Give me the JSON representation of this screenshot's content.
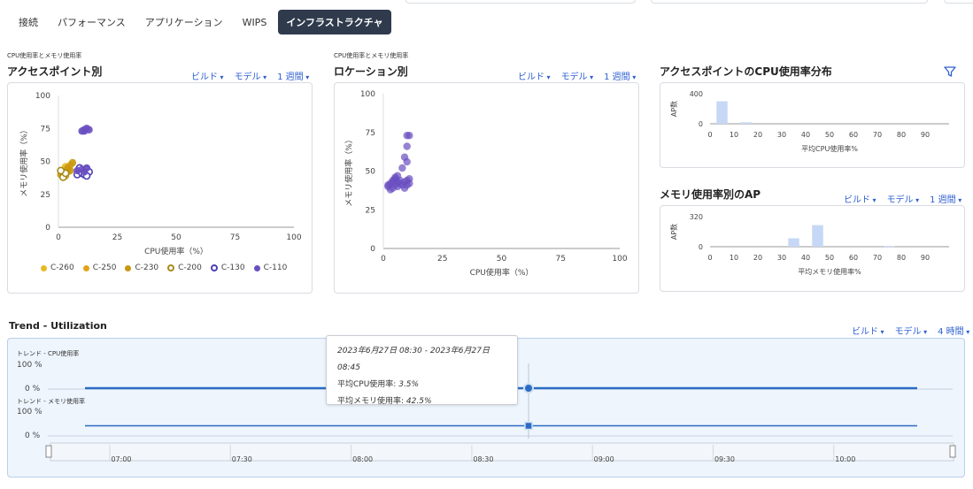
{
  "tabs": [
    {
      "label": "接続",
      "active": false
    },
    {
      "label": "パフォーマンス",
      "active": false
    },
    {
      "label": "アプリケーション",
      "active": false
    },
    {
      "label": "WIPS",
      "active": false
    },
    {
      "label": "インフラストラクチャ",
      "active": true
    }
  ],
  "scatter_ap": {
    "caption": "CPU使用率とメモリ使用率",
    "title": "アクセスポイント別",
    "filters": [
      "ビルド",
      "モデル",
      "1 週間"
    ]
  },
  "scatter_loc": {
    "caption": "CPU使用率とメモリ使用率",
    "title": "ロケーション別",
    "filters": [
      "ビルド",
      "モデル",
      "1 週間"
    ]
  },
  "cpu_dist": {
    "title": "アクセスポイントのCPU使用率分布"
  },
  "mem_dist": {
    "title": "メモリ使用率別のAP",
    "filters": [
      "ビルド",
      "モデル",
      "1 週間"
    ]
  },
  "legend": [
    {
      "label": "C-260",
      "color": "#e8b923",
      "style": "dot"
    },
    {
      "label": "C-250",
      "color": "#e0a41a",
      "style": "dot"
    },
    {
      "label": "C-230",
      "color": "#c9980f",
      "style": "dot"
    },
    {
      "label": "C-200",
      "color": "#a88a18",
      "style": "ring"
    },
    {
      "label": "C-130",
      "color": "#4b3fb4",
      "style": "ring"
    },
    {
      "label": "C-110",
      "color": "#6a4fc1",
      "style": "dot"
    }
  ],
  "chart_data": [
    {
      "type": "scatter",
      "title": "アクセスポイント別",
      "xlabel": "CPU使用率（%）",
      "ylabel": "メモリ使用率（%）",
      "xlim": [
        0,
        100
      ],
      "ylim": [
        0,
        100
      ],
      "xticks": [
        "0",
        "25",
        "50",
        "75",
        "100"
      ],
      "yticks": [
        "0",
        "25",
        "50",
        "75",
        "100"
      ],
      "series": [
        {
          "name": "C-260",
          "color": "#e8b923",
          "points": [
            [
              2,
              43
            ],
            [
              3,
              46
            ],
            [
              2,
              40
            ],
            [
              4,
              44
            ]
          ]
        },
        {
          "name": "C-250",
          "color": "#e0a41a",
          "points": [
            [
              3,
              41
            ],
            [
              5,
              47
            ],
            [
              4,
              42
            ]
          ]
        },
        {
          "name": "C-230",
          "color": "#c9980f",
          "points": [
            [
              1,
              40
            ],
            [
              2,
              42
            ],
            [
              3,
              39
            ],
            [
              5,
              43
            ],
            [
              6,
              49
            ],
            [
              4,
              45
            ]
          ]
        },
        {
          "name": "C-200",
          "color": "#a88a18",
          "points": [
            [
              2,
              38
            ],
            [
              3,
              41
            ],
            [
              1,
              43
            ]
          ]
        },
        {
          "name": "C-130",
          "color": "#4b3fb4",
          "points": [
            [
              8,
              40
            ],
            [
              9,
              43
            ],
            [
              10,
              41
            ],
            [
              12,
              44
            ],
            [
              11,
              40
            ],
            [
              13,
              42
            ],
            [
              9,
              45
            ],
            [
              12,
              39
            ]
          ]
        },
        {
          "name": "C-110",
          "color": "#6a4fc1",
          "points": [
            [
              10,
              73
            ],
            [
              11,
              74
            ],
            [
              12,
              75
            ],
            [
              11,
              73
            ],
            [
              13,
              74
            ],
            [
              8,
              43
            ],
            [
              10,
              44
            ],
            [
              11,
              42
            ],
            [
              12,
              45
            ]
          ]
        }
      ]
    },
    {
      "type": "scatter",
      "title": "ロケーション別",
      "xlabel": "CPU使用率（%）",
      "ylabel": "メモリ使用率（%）",
      "xlim": [
        0,
        100
      ],
      "ylim": [
        0,
        100
      ],
      "xticks": [
        "0",
        "25",
        "50",
        "75",
        "100"
      ],
      "yticks": [
        "0",
        "25",
        "50",
        "75",
        "100"
      ],
      "series": [
        {
          "name": "",
          "color": "#6a4fc1",
          "points": [
            [
              2,
              40
            ],
            [
              3,
              42
            ],
            [
              4,
              44
            ],
            [
              5,
              41
            ],
            [
              6,
              43
            ],
            [
              3,
              38
            ],
            [
              4,
              39
            ],
            [
              2,
              41
            ],
            [
              5,
              45
            ],
            [
              6,
              40
            ],
            [
              7,
              42
            ],
            [
              8,
              41
            ],
            [
              9,
              43
            ],
            [
              10,
              44
            ],
            [
              11,
              42
            ],
            [
              9,
              39
            ],
            [
              10,
              41
            ],
            [
              11,
              45
            ],
            [
              10,
              73
            ],
            [
              11,
              73
            ],
            [
              10,
              66
            ],
            [
              9,
              59
            ],
            [
              8,
              52
            ],
            [
              10,
              56
            ],
            [
              5,
              46
            ],
            [
              6,
              47
            ],
            [
              4,
              43
            ],
            [
              7,
              44
            ]
          ]
        }
      ]
    },
    {
      "type": "bar",
      "title": "アクセスポイントのCPU使用率分布",
      "xlabel": "平均CPU使用率%",
      "ylabel": "AP数",
      "categories": [
        "0",
        "10",
        "20",
        "30",
        "40",
        "50",
        "60",
        "70",
        "80",
        "90"
      ],
      "yticks": [
        "0",
        "400"
      ],
      "ylim": [
        0,
        400
      ],
      "bins": [
        [
          2.5,
          7.5,
          300
        ],
        [
          12.5,
          17.5,
          20
        ]
      ]
    },
    {
      "type": "bar",
      "title": "メモリ使用率別のAP",
      "xlabel": "平均メモリ使用率%",
      "ylabel": "AP数",
      "categories": [
        "0",
        "10",
        "20",
        "30",
        "40",
        "50",
        "60",
        "70",
        "80",
        "90"
      ],
      "yticks": [
        "0",
        "320"
      ],
      "ylim": [
        0,
        320
      ],
      "bins": [
        [
          32.5,
          37.5,
          90
        ],
        [
          42.5,
          47.5,
          230
        ],
        [
          72.5,
          77.5,
          8
        ]
      ]
    }
  ],
  "trend": {
    "title": "Trend - Utilization",
    "filters": [
      "ビルド",
      "モデル",
      "4 時間"
    ],
    "cpu_label": "トレンド - CPU使用率",
    "mem_label": "トレンド - メモリ使用率",
    "tick_100": "100 %",
    "tick_0": "0 %",
    "time_ticks": [
      "07:00",
      "07:30",
      "08:00",
      "08:30",
      "09:00",
      "09:30",
      "10:00"
    ],
    "tooltip": {
      "range_from": "2023年6月27日",
      "range_from_time": "08:30",
      "separator": "-",
      "range_to": "2023年6月27日",
      "range_to_time": "08:45",
      "cpu_label": "平均CPU使用率:",
      "cpu_value": "3.5%",
      "mem_label": "平均メモリ使用率:",
      "mem_value": "42.5%"
    },
    "avg_cpu_percent": 3.5,
    "avg_mem_percent": 42.5
  }
}
